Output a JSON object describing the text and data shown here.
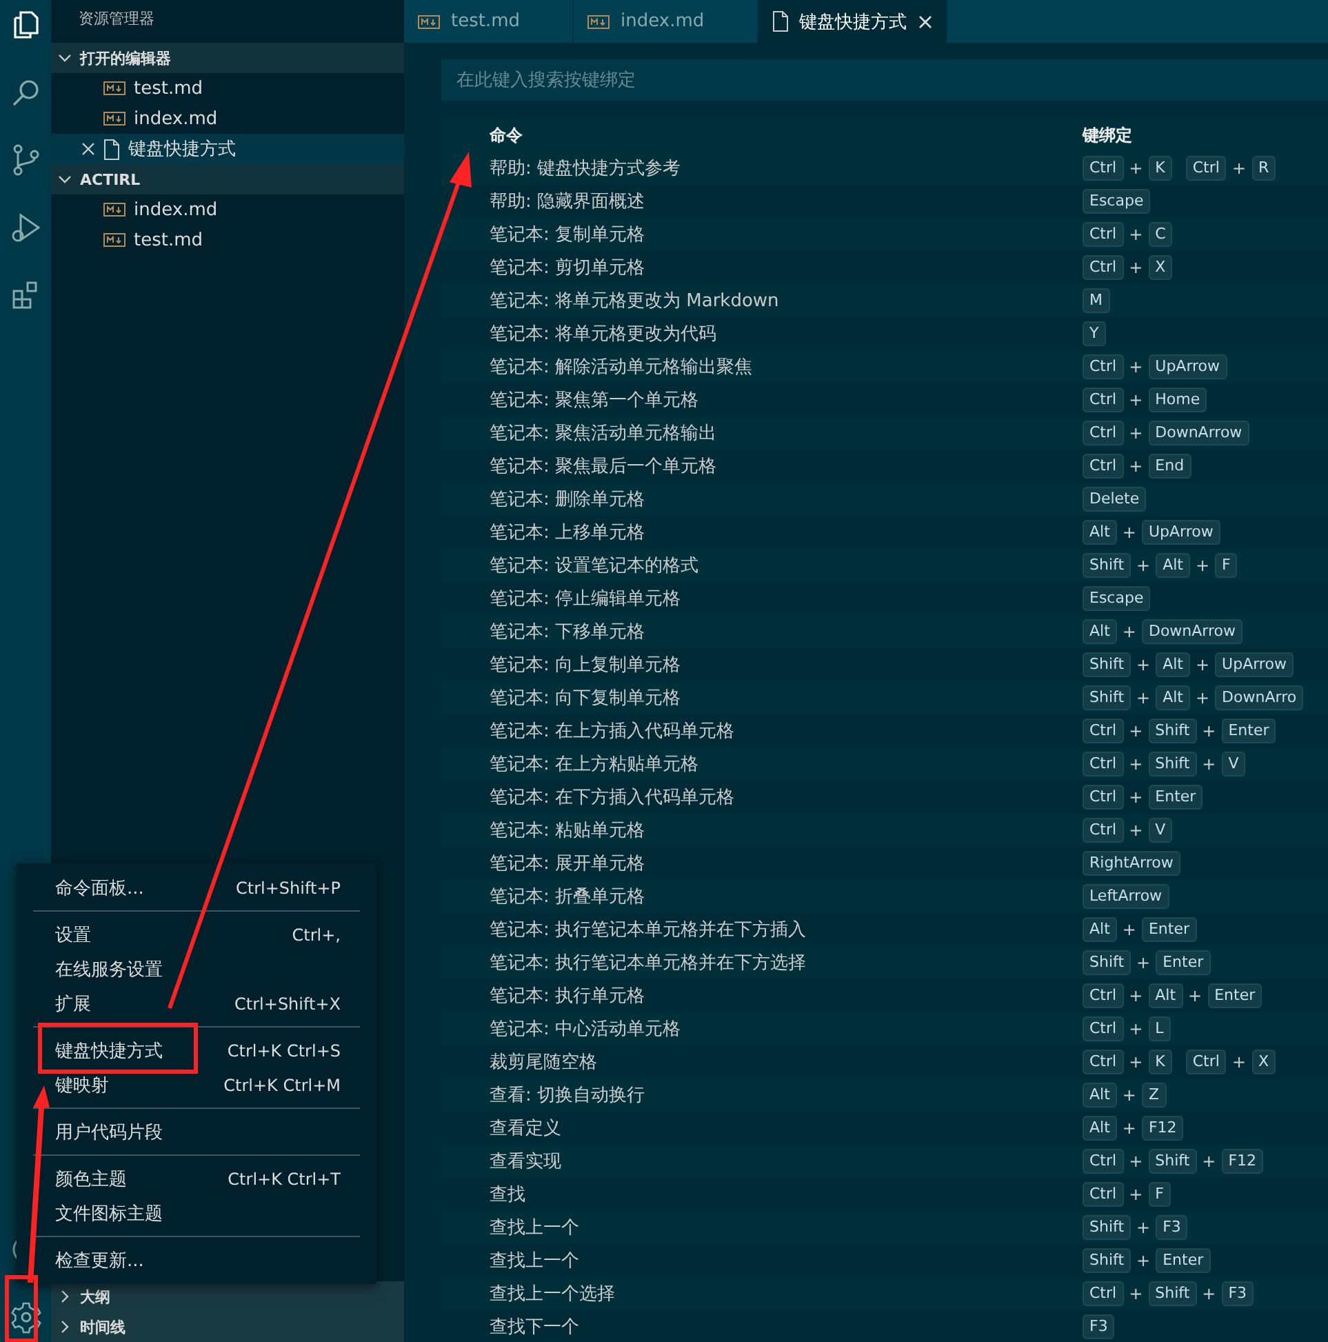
{
  "sidebar": {
    "title": "资源管理器",
    "sections": [
      {
        "label": "打开的编辑器",
        "expanded": true,
        "items": [
          {
            "label": "test.md",
            "kind": "markdown",
            "selected": false
          },
          {
            "label": "index.md",
            "kind": "markdown",
            "selected": false
          },
          {
            "label": "键盘快捷方式",
            "kind": "document",
            "selected": true
          }
        ]
      },
      {
        "label": "ACTIRL",
        "expanded": true,
        "items": [
          {
            "label": "index.md",
            "kind": "markdown",
            "selected": false
          },
          {
            "label": "test.md",
            "kind": "markdown",
            "selected": false
          }
        ]
      }
    ],
    "bottom_sections": [
      {
        "label": "大纲",
        "expanded": false
      },
      {
        "label": "时间线",
        "expanded": false
      }
    ]
  },
  "tabs": [
    {
      "label": "test.md",
      "kind": "markdown",
      "selected": false
    },
    {
      "label": "index.md",
      "kind": "markdown",
      "selected": false
    },
    {
      "label": "键盘快捷方式",
      "kind": "document",
      "selected": true
    }
  ],
  "search": {
    "placeholder": "在此键入搜索按键绑定"
  },
  "table": {
    "columns": [
      "命令",
      "键绑定"
    ],
    "rows": [
      {
        "command": "帮助: 键盘快捷方式参考",
        "chords": [
          [
            "Ctrl",
            "+",
            "K"
          ],
          [
            "Ctrl",
            "+",
            "R"
          ]
        ]
      },
      {
        "command": "帮助: 隐藏界面概述",
        "chords": [
          [
            "Escape"
          ]
        ]
      },
      {
        "command": "笔记本: 复制单元格",
        "chords": [
          [
            "Ctrl",
            "+",
            "C"
          ]
        ]
      },
      {
        "command": "笔记本: 剪切单元格",
        "chords": [
          [
            "Ctrl",
            "+",
            "X"
          ]
        ]
      },
      {
        "command": "笔记本: 将单元格更改为 Markdown",
        "chords": [
          [
            "M"
          ]
        ]
      },
      {
        "command": "笔记本: 将单元格更改为代码",
        "chords": [
          [
            "Y"
          ]
        ]
      },
      {
        "command": "笔记本: 解除活动单元格输出聚焦",
        "chords": [
          [
            "Ctrl",
            "+",
            "UpArrow"
          ]
        ]
      },
      {
        "command": "笔记本: 聚焦第一个单元格",
        "chords": [
          [
            "Ctrl",
            "+",
            "Home"
          ]
        ]
      },
      {
        "command": "笔记本: 聚焦活动单元格输出",
        "chords": [
          [
            "Ctrl",
            "+",
            "DownArrow"
          ]
        ]
      },
      {
        "command": "笔记本: 聚焦最后一个单元格",
        "chords": [
          [
            "Ctrl",
            "+",
            "End"
          ]
        ]
      },
      {
        "command": "笔记本: 删除单元格",
        "chords": [
          [
            "Delete"
          ]
        ]
      },
      {
        "command": "笔记本: 上移单元格",
        "chords": [
          [
            "Alt",
            "+",
            "UpArrow"
          ]
        ]
      },
      {
        "command": "笔记本: 设置笔记本的格式",
        "chords": [
          [
            "Shift",
            "+",
            "Alt",
            "+",
            "F"
          ]
        ]
      },
      {
        "command": "笔记本: 停止编辑单元格",
        "chords": [
          [
            "Escape"
          ]
        ]
      },
      {
        "command": "笔记本: 下移单元格",
        "chords": [
          [
            "Alt",
            "+",
            "DownArrow"
          ]
        ]
      },
      {
        "command": "笔记本: 向上复制单元格",
        "chords": [
          [
            "Shift",
            "+",
            "Alt",
            "+",
            "UpArrow"
          ]
        ]
      },
      {
        "command": "笔记本: 向下复制单元格",
        "chords": [
          [
            "Shift",
            "+",
            "Alt",
            "+",
            "DownArro"
          ]
        ]
      },
      {
        "command": "笔记本: 在上方插入代码单元格",
        "chords": [
          [
            "Ctrl",
            "+",
            "Shift",
            "+",
            "Enter"
          ]
        ]
      },
      {
        "command": "笔记本: 在上方粘贴单元格",
        "chords": [
          [
            "Ctrl",
            "+",
            "Shift",
            "+",
            "V"
          ]
        ]
      },
      {
        "command": "笔记本: 在下方插入代码单元格",
        "chords": [
          [
            "Ctrl",
            "+",
            "Enter"
          ]
        ]
      },
      {
        "command": "笔记本: 粘贴单元格",
        "chords": [
          [
            "Ctrl",
            "+",
            "V"
          ]
        ]
      },
      {
        "command": "笔记本: 展开单元格",
        "chords": [
          [
            "RightArrow"
          ]
        ]
      },
      {
        "command": "笔记本: 折叠单元格",
        "chords": [
          [
            "LeftArrow"
          ]
        ]
      },
      {
        "command": "笔记本: 执行笔记本单元格并在下方插入",
        "chords": [
          [
            "Alt",
            "+",
            "Enter"
          ]
        ]
      },
      {
        "command": "笔记本: 执行笔记本单元格并在下方选择",
        "chords": [
          [
            "Shift",
            "+",
            "Enter"
          ]
        ]
      },
      {
        "command": "笔记本: 执行单元格",
        "chords": [
          [
            "Ctrl",
            "+",
            "Alt",
            "+",
            "Enter"
          ]
        ]
      },
      {
        "command": "笔记本: 中心活动单元格",
        "chords": [
          [
            "Ctrl",
            "+",
            "L"
          ]
        ]
      },
      {
        "command": "裁剪尾随空格",
        "chords": [
          [
            "Ctrl",
            "+",
            "K"
          ],
          [
            "Ctrl",
            "+",
            "X"
          ]
        ]
      },
      {
        "command": "查看: 切换自动换行",
        "chords": [
          [
            "Alt",
            "+",
            "Z"
          ]
        ]
      },
      {
        "command": "查看定义",
        "chords": [
          [
            "Alt",
            "+",
            "F12"
          ]
        ]
      },
      {
        "command": "查看实现",
        "chords": [
          [
            "Ctrl",
            "+",
            "Shift",
            "+",
            "F12"
          ]
        ]
      },
      {
        "command": "查找",
        "chords": [
          [
            "Ctrl",
            "+",
            "F"
          ]
        ]
      },
      {
        "command": "查找上一个",
        "chords": [
          [
            "Shift",
            "+",
            "F3"
          ]
        ]
      },
      {
        "command": "查找上一个",
        "chords": [
          [
            "Shift",
            "+",
            "Enter"
          ]
        ]
      },
      {
        "command": "查找上一个选择",
        "chords": [
          [
            "Ctrl",
            "+",
            "Shift",
            "+",
            "F3"
          ]
        ]
      },
      {
        "command": "查找下一个",
        "chords": [
          [
            "F3"
          ]
        ]
      }
    ]
  },
  "menu": {
    "groups": [
      [
        {
          "label": "命令面板...",
          "shortcut": "Ctrl+Shift+P"
        }
      ],
      [
        {
          "label": "设置",
          "shortcut": "Ctrl+,"
        },
        {
          "label": "在线服务设置"
        },
        {
          "label": "扩展",
          "shortcut": "Ctrl+Shift+X"
        }
      ],
      [
        {
          "label": "键盘快捷方式",
          "shortcut": "Ctrl+K Ctrl+S"
        },
        {
          "label": "键映射",
          "shortcut": "Ctrl+K Ctrl+M"
        }
      ],
      [
        {
          "label": "用户代码片段"
        }
      ],
      [
        {
          "label": "颜色主题",
          "shortcut": "Ctrl+K Ctrl+T"
        },
        {
          "label": "文件图标主题"
        }
      ],
      [
        {
          "label": "检查更新..."
        }
      ]
    ]
  }
}
